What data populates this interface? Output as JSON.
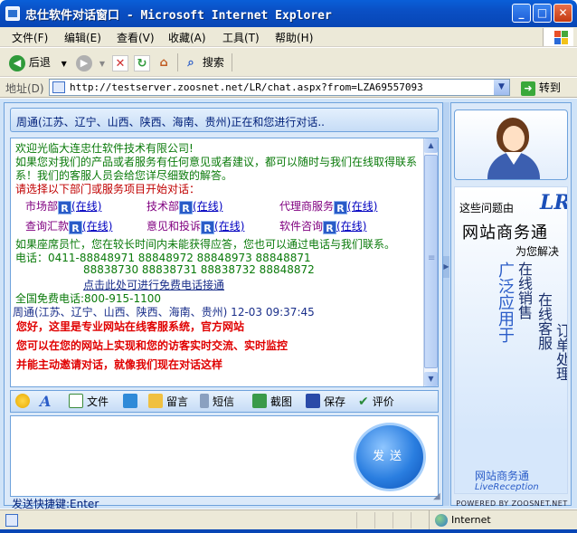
{
  "window": {
    "title": "忠仕软件对话窗口 - Microsoft Internet Explorer",
    "minimize": "_",
    "maximize": "□",
    "close": "✕"
  },
  "menu": [
    "文件(F)",
    "编辑(E)",
    "查看(V)",
    "收藏(A)",
    "工具(T)",
    "帮助(H)"
  ],
  "toolbar": {
    "back": "后退",
    "search": "搜索"
  },
  "address": {
    "label": "地址(D)",
    "url": "http://testserver.zoosnet.net/LR/chat.aspx?from=LZA69557093",
    "go": "转到"
  },
  "chat": {
    "header": "周通(江苏、辽宁、山西、陕西、海南、贵州)正在和您进行对话..",
    "welcome": "欢迎光临大连忠仕软件技术有限公司!",
    "intro1": "如果您对我们的产品或者服务有任何意见或者建议，都可以随时与我们在线取得联系",
    "intro2": "系！我们的客服人员会给您详尽细致的解答。",
    "select_prompt": "请选择以下部门或服务项目开始对话：",
    "departments": [
      {
        "name": "市场部",
        "status": "(在线)"
      },
      {
        "name": "技术部",
        "status": "(在线)"
      },
      {
        "name": "代理商服务",
        "status": "(在线)"
      },
      {
        "name": "查询汇款",
        "status": "(在线)"
      },
      {
        "name": "意见和投诉",
        "status": "(在线)"
      },
      {
        "name": "软件咨询",
        "status": "(在线)"
      }
    ],
    "busy_note": "如果座席员忙，您在较长时间内未能获得应答，您也可以通过电话与我们联系。",
    "phone_line1": "电话：0411-88848971 88848972 88848973 88848871",
    "phone_line2": "88838730 88838731 88838732 88848872",
    "free_call_link": "点击此处可进行免费电话接通",
    "toll_free_label": "全国免费电话:",
    "toll_free_number": "800-915-1100",
    "message_meta": "周通(江苏、辽宁、山西、陕西、海南、贵州) 12-03 09:37:45",
    "message_lines": [
      "您好，这里是专业网站在线客服系统，官方网站",
      "您可以在您的网站上实现和您的访客实时交流、实时监控",
      "并能主动邀请对话，就像我们现在对话这样"
    ]
  },
  "tools": [
    {
      "label": "",
      "icon": "smiley-icon"
    },
    {
      "label": "",
      "icon": "font-icon"
    },
    {
      "label": "文件",
      "icon": "file-icon"
    },
    {
      "label": "",
      "icon": "phone-icon"
    },
    {
      "label": "留言",
      "icon": "message-icon"
    },
    {
      "label": "短信",
      "icon": "sms-icon"
    },
    {
      "label": "截图",
      "icon": "screenshot-icon"
    },
    {
      "label": "保存",
      "icon": "save-icon"
    },
    {
      "label": "评价",
      "icon": "rate-icon"
    }
  ],
  "send_button": "发送",
  "send_hint": "发送快捷键:Enter",
  "ad": {
    "question": "这些问题由",
    "logo": "LR",
    "title": "网站商务通",
    "subtitle": "为您解决",
    "col1": "广泛应用于",
    "col2": "在线销售",
    "col3": "在线客服",
    "col4": "订单处理",
    "brand": "网站商务通",
    "brand_en": "LiveReception",
    "powered": "POWERED BY ZOOSNET.NET"
  },
  "status": {
    "zone": "Internet"
  },
  "colors": {
    "green_text": "#0a7a0a",
    "red_text": "#c00000",
    "big_red": "#e00000",
    "accent_blue": "#2a5cc8"
  }
}
